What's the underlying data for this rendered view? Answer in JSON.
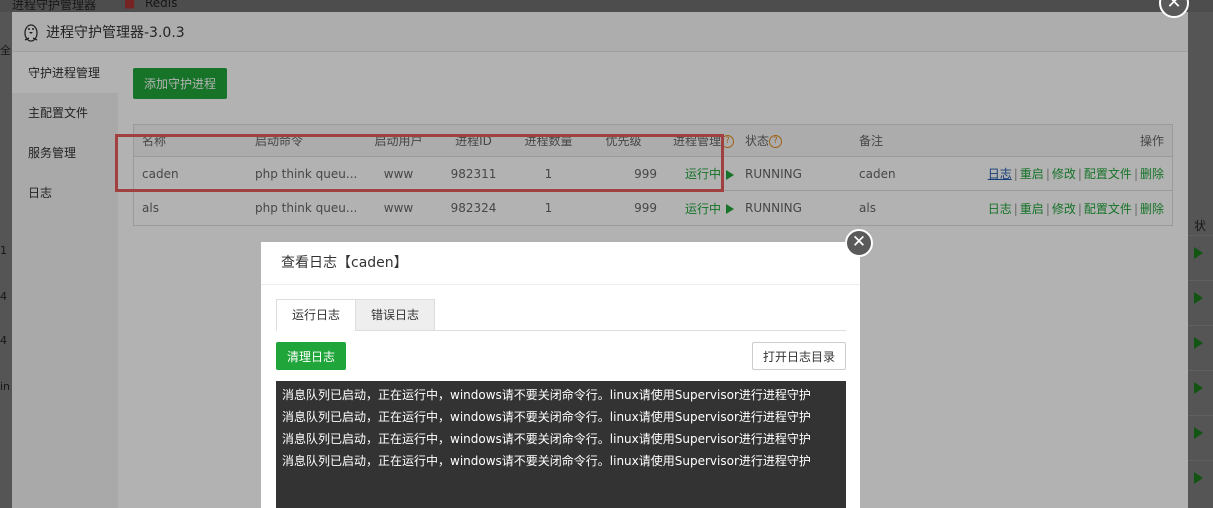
{
  "background": {
    "top_items": [
      "进程守护管理器",
      "Redis"
    ],
    "left_fragments": [
      "全",
      "1",
      "4",
      "4",
      "in"
    ],
    "right_header": "状"
  },
  "window": {
    "title": "进程守护管理器-3.0.3",
    "close_label": "✕"
  },
  "sidebar": {
    "items": [
      {
        "label": "守护进程管理"
      },
      {
        "label": "主配置文件"
      },
      {
        "label": "服务管理"
      },
      {
        "label": "日志"
      }
    ]
  },
  "main": {
    "add_button": "添加守护进程",
    "columns": {
      "name": "名称",
      "command": "启动命令",
      "user": "启动用户",
      "pid": "进程ID",
      "count": "进程数量",
      "priority": "优先级",
      "manage": "进程管理",
      "status": "状态",
      "note": "备注",
      "ops": "操作"
    },
    "help_icon": "?",
    "rows": [
      {
        "name": "caden",
        "command": "php think queu...",
        "user": "www",
        "pid": "982311",
        "count": "1",
        "priority": "999",
        "manage": "运行中",
        "status": "RUNNING",
        "note": "caden"
      },
      {
        "name": "als",
        "command": "php think queu...",
        "user": "www",
        "pid": "982324",
        "count": "1",
        "priority": "999",
        "manage": "运行中",
        "status": "RUNNING",
        "note": "als"
      }
    ],
    "ops": {
      "log": "日志",
      "restart": "重启",
      "edit": "修改",
      "config": "配置文件",
      "delete": "删除",
      "sep": "|"
    }
  },
  "modal": {
    "title": "查看日志【caden】",
    "close_label": "✕",
    "tabs": [
      {
        "label": "运行日志"
      },
      {
        "label": "错误日志"
      }
    ],
    "clear_button": "清理日志",
    "open_dir_button": "打开日志目录",
    "log_lines": [
      "消息队列已启动，正在运行中，windows请不要关闭命令行。linux请使用Supervisor进行进程守护",
      "消息队列已启动，正在运行中，windows请不要关闭命令行。linux请使用Supervisor进行进程守护",
      "消息队列已启动，正在运行中，windows请不要关闭命令行。linux请使用Supervisor进行进程守护",
      "消息队列已启动，正在运行中，windows请不要关闭命令行。linux请使用Supervisor进行进程守护"
    ]
  },
  "colors": {
    "accent": "#20a53a",
    "highlight": "#e65c5c",
    "link_blue": "#1e5aa8",
    "help": "#e28a1b"
  }
}
